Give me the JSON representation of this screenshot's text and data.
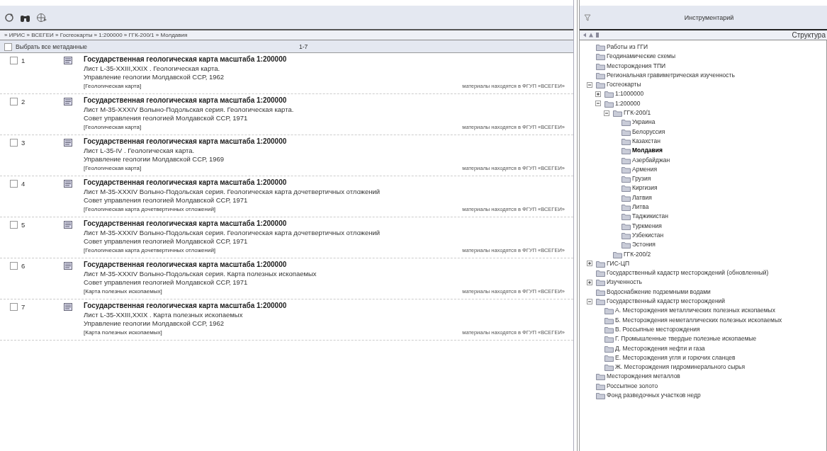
{
  "results": {
    "breadcrumb": "» ИРИС » ВСЕГЕИ » Госгеокарты » 1:200000 » ГГК-200/1 » Молдавия",
    "select_all": {
      "label": "Выбрать все метаданные",
      "checked": false
    },
    "range": "1-7",
    "records": [
      {
        "number": "1",
        "checked": false,
        "title": "Государственная геологическая карта масштаба 1:200000",
        "sheet": "Лист L-35-XXIII,XXIX . Геологическая карта.",
        "publisher": "Управление геологии Молдавской ССР, 1962",
        "type": "[Геологическая карта]",
        "location": "материалы находятся в ФГУП «ВСЕГЕИ»"
      },
      {
        "number": "2",
        "checked": false,
        "title": "Государственная геологическая карта масштаба 1:200000",
        "sheet": "Лист M-35-XXXIV Волыно-Подольская серия. Геологическая карта.",
        "publisher": "Совет управления геологией Молдавской ССР, 1971",
        "type": "[Геологическая карта]",
        "location": "материалы находятся в ФГУП «ВСЕГЕИ»"
      },
      {
        "number": "3",
        "checked": false,
        "title": "Государственная геологическая карта масштаба 1:200000",
        "sheet": "Лист L-35-IV . Геологическая карта.",
        "publisher": "Управление геологии Молдавской ССР, 1969",
        "type": "[Геологическая карта]",
        "location": "материалы находятся в ФГУП «ВСЕГЕИ»"
      },
      {
        "number": "4",
        "checked": false,
        "title": "Государственная геологическая карта масштаба 1:200000",
        "sheet": "Лист M-35-XXXIV Волыно-Подольская серия. Геологическая карта дочетвертичных отложений",
        "publisher": "Совет управления геологией Молдавской ССР, 1971",
        "type": "[Геологическая карта дочетвертичных отложений]",
        "location": "материалы находятся в ФГУП «ВСЕГЕИ»"
      },
      {
        "number": "5",
        "checked": false,
        "title": "Государственная геологическая карта масштаба 1:200000",
        "sheet": "Лист M-35-XXXIV Волыно-Подольская серия. Геологическая карта дочетвертичных отложений",
        "publisher": "Совет управления геологией Молдавской ССР, 1971",
        "type": "[Геологическая карта дочетвертичных отложений]",
        "location": "материалы находятся в ФГУП «ВСЕГЕИ»"
      },
      {
        "number": "6",
        "checked": false,
        "title": "Государственная геологическая карта масштаба 1:200000",
        "sheet": "Лист M-35-XXXIV Волыно-Подольская серия. Карта полезных ископаемых",
        "publisher": "Совет управления геологией Молдавской ССР, 1971",
        "type": "[Карта полезных ископаемых]",
        "location": "материалы находятся в ФГУП «ВСЕГЕИ»"
      },
      {
        "number": "7",
        "checked": false,
        "title": "Государственная геологическая карта масштаба 1:200000",
        "sheet": "Лист L-35-XXIII,XXIX . Карта полезных ископаемых",
        "publisher": "Управление геологии Молдавской ССР, 1962",
        "type": "[Карта полезных ископаемых]",
        "location": "материалы находятся в ФГУП «ВСЕГЕИ»"
      }
    ]
  },
  "tools": {
    "title": "Инструментарий",
    "view": "Структура",
    "tree": [
      {
        "label": "Работы из ГГИ",
        "selected": false
      },
      {
        "label": "Геодинамические схемы",
        "selected": false
      },
      {
        "label": "Месторождения ТПИ",
        "selected": false
      },
      {
        "label": "Региональная гравиметрическая изученность",
        "selected": false
      },
      {
        "label": "Госгеокарты",
        "selected": false,
        "expanded": true,
        "children": [
          {
            "label": "1:1000000",
            "selected": false,
            "expanded": false
          },
          {
            "label": "1:200000",
            "selected": false,
            "expanded": true,
            "children": [
              {
                "label": "ГГК-200/1",
                "selected": false,
                "expanded": true,
                "children": [
                  {
                    "label": "Украина",
                    "selected": false
                  },
                  {
                    "label": "Белоруссия",
                    "selected": false
                  },
                  {
                    "label": "Казахстан",
                    "selected": false
                  },
                  {
                    "label": "Молдавия",
                    "selected": true
                  },
                  {
                    "label": "Азербайджан",
                    "selected": false
                  },
                  {
                    "label": "Армения",
                    "selected": false
                  },
                  {
                    "label": "Грузия",
                    "selected": false
                  },
                  {
                    "label": "Киргизия",
                    "selected": false
                  },
                  {
                    "label": "Латвия",
                    "selected": false
                  },
                  {
                    "label": "Литва",
                    "selected": false
                  },
                  {
                    "label": "Таджикистан",
                    "selected": false
                  },
                  {
                    "label": "Туркмения",
                    "selected": false
                  },
                  {
                    "label": "Узбекистан",
                    "selected": false
                  },
                  {
                    "label": "Эстония",
                    "selected": false
                  }
                ]
              },
              {
                "label": "ГГК-200/2",
                "selected": false
              }
            ]
          }
        ]
      },
      {
        "label": "ГИС-ЦП",
        "selected": false,
        "expanded": false
      },
      {
        "label": "Государственный кадастр месторождений (обновленный)",
        "selected": false
      },
      {
        "label": "Изученность",
        "selected": false,
        "expanded": false
      },
      {
        "label": "Водоснабжение подземными водами",
        "selected": false
      },
      {
        "label": "Государственный кадастр месторождений",
        "selected": false,
        "expanded": true,
        "children": [
          {
            "label": "А. Месторождения металлических полезных ископаемых",
            "selected": false
          },
          {
            "label": "Б. Месторождения неметаллических полезных ископаемых",
            "selected": false
          },
          {
            "label": "В. Россыпные месторождения",
            "selected": false
          },
          {
            "label": "Г. Промышленные твердые полезные ископаемые",
            "selected": false
          },
          {
            "label": "Д. Месторождения нефти и газа",
            "selected": false
          },
          {
            "label": "Е. Месторождения угля и горючих сланцев",
            "selected": false
          },
          {
            "label": "Ж. Месторождения гидроминерального сырья",
            "selected": false
          }
        ]
      },
      {
        "label": "Месторождения металлов",
        "selected": false
      },
      {
        "label": "Россыпное золото",
        "selected": false
      },
      {
        "label": "Фонд разведочных участков недр",
        "selected": false
      }
    ]
  }
}
